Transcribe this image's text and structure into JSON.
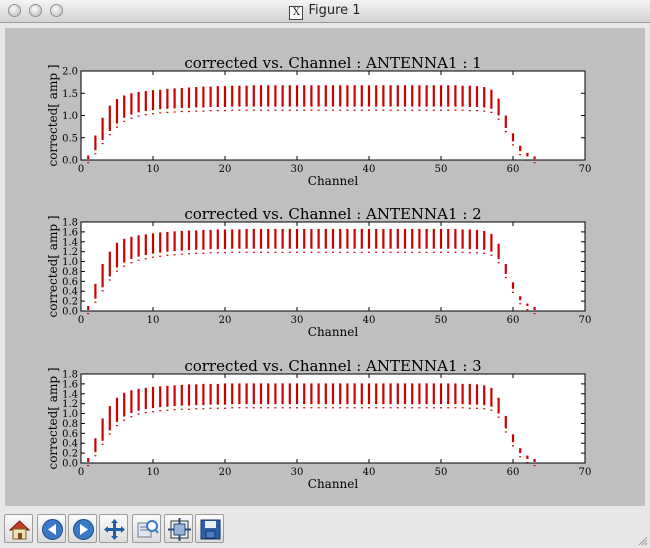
{
  "window": {
    "title": "Figure 1"
  },
  "colors": {
    "data": "#cc0000",
    "canvas_bg": "#bfbfbf",
    "axes_bg": "#ffffff"
  },
  "toolbar": {
    "icons": [
      "home-icon",
      "back-arrow-icon",
      "forward-arrow-icon",
      "pan-move-icon",
      "zoom-rect-icon",
      "configure-subplots-icon",
      "save-icon"
    ]
  },
  "chart_data": [
    {
      "type": "scatter",
      "title": "corrected vs. Channel : ANTENNA1 :  1",
      "xlabel": "Channel",
      "ylabel": "corrected[ amp ]",
      "xlim": [
        0,
        70
      ],
      "ylim": [
        0,
        2.0
      ],
      "xticks": [
        "0",
        "10",
        "20",
        "30",
        "40",
        "50",
        "60",
        "70"
      ],
      "yticks": [
        "0.0",
        "0.5",
        "1.0",
        "1.5",
        "2.0"
      ],
      "grid": false,
      "x": [
        1,
        2,
        3,
        4,
        5,
        6,
        7,
        8,
        9,
        10,
        11,
        12,
        13,
        14,
        15,
        16,
        17,
        18,
        19,
        20,
        21,
        22,
        23,
        24,
        25,
        26,
        27,
        28,
        29,
        30,
        31,
        32,
        33,
        34,
        35,
        36,
        37,
        38,
        39,
        40,
        41,
        42,
        43,
        44,
        45,
        46,
        47,
        48,
        49,
        50,
        51,
        52,
        53,
        54,
        55,
        56,
        57,
        58,
        59,
        60,
        61,
        62,
        63
      ],
      "ymin": [
        0.02,
        0.22,
        0.45,
        0.65,
        0.82,
        0.95,
        1.02,
        1.07,
        1.1,
        1.12,
        1.14,
        1.15,
        1.16,
        1.17,
        1.17,
        1.18,
        1.18,
        1.19,
        1.19,
        1.19,
        1.2,
        1.2,
        1.2,
        1.2,
        1.2,
        1.2,
        1.2,
        1.2,
        1.2,
        1.2,
        1.2,
        1.2,
        1.2,
        1.2,
        1.2,
        1.2,
        1.2,
        1.2,
        1.2,
        1.2,
        1.2,
        1.2,
        1.2,
        1.2,
        1.2,
        1.2,
        1.2,
        1.2,
        1.2,
        1.2,
        1.2,
        1.2,
        1.2,
        1.19,
        1.19,
        1.18,
        1.15,
        1.0,
        0.72,
        0.42,
        0.2,
        0.08,
        0.02
      ],
      "ymax": [
        0.1,
        0.55,
        0.95,
        1.22,
        1.37,
        1.45,
        1.5,
        1.53,
        1.55,
        1.57,
        1.58,
        1.6,
        1.61,
        1.62,
        1.63,
        1.64,
        1.65,
        1.65,
        1.66,
        1.66,
        1.67,
        1.67,
        1.67,
        1.68,
        1.68,
        1.68,
        1.68,
        1.68,
        1.68,
        1.68,
        1.68,
        1.68,
        1.68,
        1.68,
        1.68,
        1.68,
        1.68,
        1.68,
        1.68,
        1.68,
        1.68,
        1.68,
        1.68,
        1.68,
        1.68,
        1.68,
        1.68,
        1.68,
        1.68,
        1.68,
        1.68,
        1.68,
        1.67,
        1.67,
        1.66,
        1.64,
        1.58,
        1.38,
        1.0,
        0.6,
        0.32,
        0.16,
        0.08
      ]
    },
    {
      "type": "scatter",
      "title": "corrected vs. Channel : ANTENNA1 :  2",
      "xlabel": "Channel",
      "ylabel": "corrected[ amp ]",
      "xlim": [
        0,
        70
      ],
      "ylim": [
        0,
        1.8
      ],
      "xticks": [
        "0",
        "10",
        "20",
        "30",
        "40",
        "50",
        "60",
        "70"
      ],
      "yticks": [
        "0.0",
        "0.2",
        "0.4",
        "0.6",
        "0.8",
        "1.0",
        "1.2",
        "1.4",
        "1.6",
        "1.8"
      ],
      "grid": false,
      "x": [
        1,
        2,
        3,
        4,
        5,
        6,
        7,
        8,
        9,
        10,
        11,
        12,
        13,
        14,
        15,
        16,
        17,
        18,
        19,
        20,
        21,
        22,
        23,
        24,
        25,
        26,
        27,
        28,
        29,
        30,
        31,
        32,
        33,
        34,
        35,
        36,
        37,
        38,
        39,
        40,
        41,
        42,
        43,
        44,
        45,
        46,
        47,
        48,
        49,
        50,
        51,
        52,
        53,
        54,
        55,
        56,
        57,
        58,
        59,
        60,
        61,
        62,
        63
      ],
      "ymin": [
        0.02,
        0.25,
        0.48,
        0.7,
        0.88,
        0.98,
        1.05,
        1.1,
        1.13,
        1.16,
        1.18,
        1.2,
        1.21,
        1.22,
        1.23,
        1.24,
        1.24,
        1.25,
        1.25,
        1.25,
        1.26,
        1.26,
        1.26,
        1.26,
        1.26,
        1.26,
        1.26,
        1.26,
        1.26,
        1.26,
        1.26,
        1.26,
        1.26,
        1.26,
        1.26,
        1.26,
        1.26,
        1.26,
        1.26,
        1.26,
        1.26,
        1.26,
        1.26,
        1.26,
        1.26,
        1.26,
        1.26,
        1.26,
        1.26,
        1.26,
        1.26,
        1.26,
        1.26,
        1.25,
        1.25,
        1.24,
        1.2,
        1.05,
        0.75,
        0.45,
        0.22,
        0.1,
        0.02
      ],
      "ymax": [
        0.1,
        0.55,
        0.95,
        1.2,
        1.38,
        1.46,
        1.5,
        1.53,
        1.55,
        1.57,
        1.59,
        1.6,
        1.61,
        1.62,
        1.63,
        1.63,
        1.64,
        1.64,
        1.65,
        1.65,
        1.65,
        1.65,
        1.66,
        1.66,
        1.66,
        1.66,
        1.66,
        1.66,
        1.66,
        1.66,
        1.66,
        1.66,
        1.66,
        1.66,
        1.66,
        1.66,
        1.66,
        1.66,
        1.66,
        1.66,
        1.66,
        1.66,
        1.66,
        1.66,
        1.66,
        1.66,
        1.66,
        1.66,
        1.66,
        1.66,
        1.66,
        1.66,
        1.65,
        1.65,
        1.64,
        1.62,
        1.56,
        1.36,
        0.95,
        0.58,
        0.3,
        0.15,
        0.08
      ]
    },
    {
      "type": "scatter",
      "title": "corrected vs. Channel : ANTENNA1 :  3",
      "xlabel": "Channel",
      "ylabel": "corrected[ amp ]",
      "xlim": [
        0,
        70
      ],
      "ylim": [
        0,
        1.8
      ],
      "xticks": [
        "0",
        "10",
        "20",
        "30",
        "40",
        "50",
        "60",
        "70"
      ],
      "yticks": [
        "0.0",
        "0.2",
        "0.4",
        "0.6",
        "0.8",
        "1.0",
        "1.2",
        "1.4",
        "1.6",
        "1.8"
      ],
      "grid": false,
      "x": [
        1,
        2,
        3,
        4,
        5,
        6,
        7,
        8,
        9,
        10,
        11,
        12,
        13,
        14,
        15,
        16,
        17,
        18,
        19,
        20,
        21,
        22,
        23,
        24,
        25,
        26,
        27,
        28,
        29,
        30,
        31,
        32,
        33,
        34,
        35,
        36,
        37,
        38,
        39,
        40,
        41,
        42,
        43,
        44,
        45,
        46,
        47,
        48,
        49,
        50,
        51,
        52,
        53,
        54,
        55,
        56,
        57,
        58,
        59,
        60,
        61,
        62,
        63
      ],
      "ymin": [
        0.02,
        0.22,
        0.45,
        0.66,
        0.83,
        0.94,
        1.01,
        1.06,
        1.09,
        1.11,
        1.13,
        1.14,
        1.15,
        1.16,
        1.16,
        1.17,
        1.17,
        1.18,
        1.18,
        1.18,
        1.19,
        1.19,
        1.19,
        1.19,
        1.19,
        1.19,
        1.19,
        1.19,
        1.19,
        1.19,
        1.19,
        1.19,
        1.19,
        1.19,
        1.19,
        1.19,
        1.19,
        1.19,
        1.19,
        1.19,
        1.19,
        1.19,
        1.19,
        1.19,
        1.19,
        1.19,
        1.19,
        1.19,
        1.19,
        1.19,
        1.19,
        1.19,
        1.19,
        1.18,
        1.18,
        1.17,
        1.14,
        1.0,
        0.7,
        0.42,
        0.2,
        0.08,
        0.02
      ],
      "ymax": [
        0.1,
        0.5,
        0.9,
        1.15,
        1.32,
        1.42,
        1.47,
        1.5,
        1.52,
        1.54,
        1.55,
        1.56,
        1.57,
        1.58,
        1.59,
        1.59,
        1.6,
        1.6,
        1.6,
        1.61,
        1.61,
        1.61,
        1.61,
        1.61,
        1.61,
        1.61,
        1.61,
        1.61,
        1.61,
        1.61,
        1.61,
        1.61,
        1.61,
        1.61,
        1.61,
        1.61,
        1.61,
        1.61,
        1.61,
        1.61,
        1.61,
        1.61,
        1.61,
        1.61,
        1.61,
        1.61,
        1.61,
        1.61,
        1.61,
        1.61,
        1.61,
        1.61,
        1.6,
        1.6,
        1.59,
        1.57,
        1.52,
        1.32,
        0.95,
        0.58,
        0.3,
        0.15,
        0.08
      ]
    }
  ]
}
